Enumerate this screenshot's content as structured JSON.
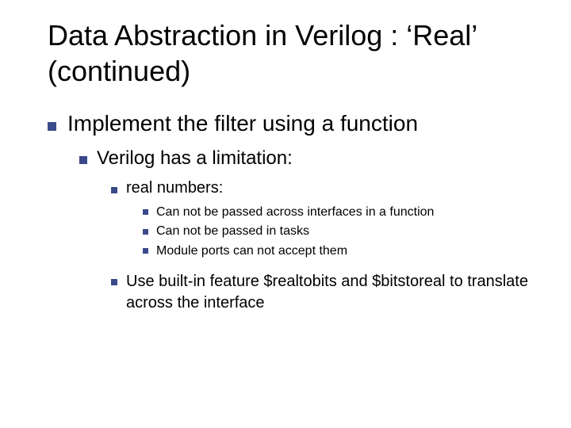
{
  "title": "Data Abstraction in Verilog : ‘Real’ (continued)",
  "l1": "Implement the filter using a function",
  "l2": "Verilog has a limitation:",
  "l3a": "real numbers:",
  "l4a": "Can not be passed across interfaces in a function",
  "l4b": "Can not be passed in tasks",
  "l4c": "Module ports can not accept them",
  "l3b": "Use built-in feature $realtobits and $bitstoreal to translate across the interface"
}
